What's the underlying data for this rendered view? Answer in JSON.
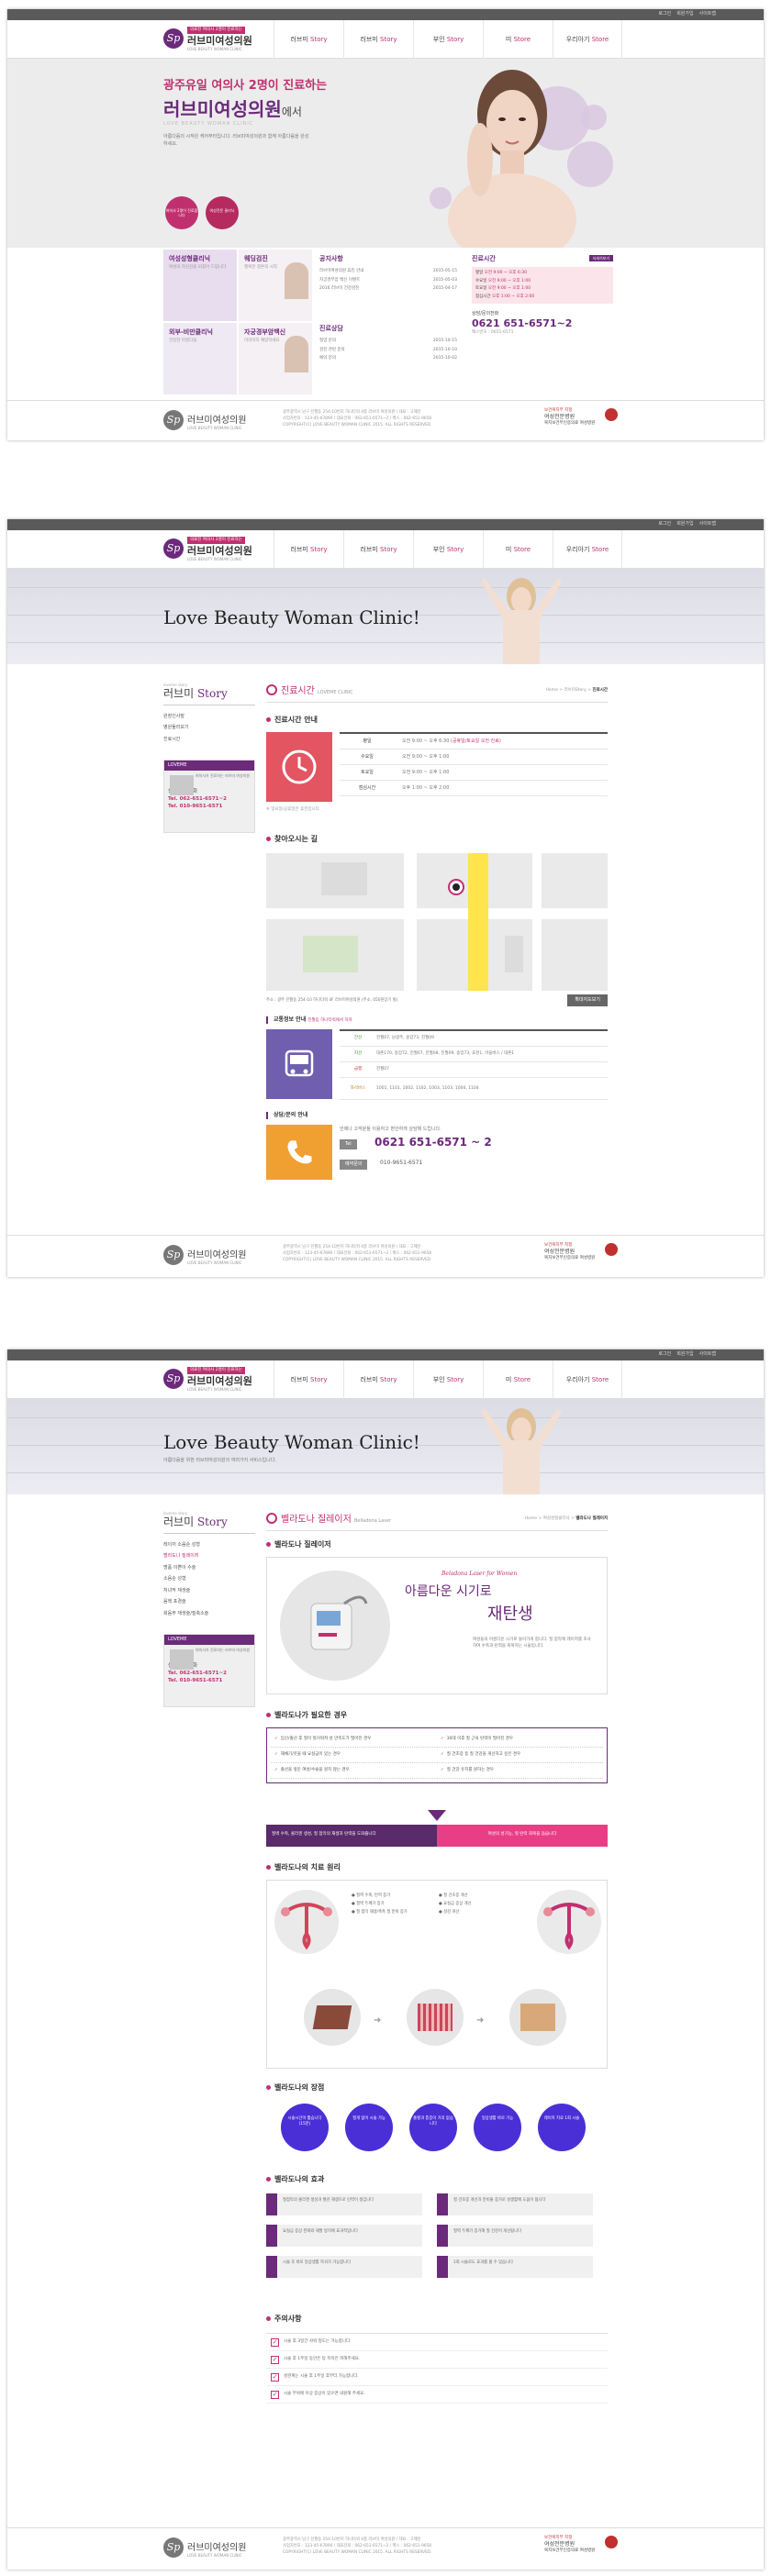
{
  "common": {
    "util": [
      "로그인",
      "회원가입",
      "사이트맵",
      "이용약관"
    ],
    "logo": {
      "mark": "Sp",
      "tagline": "의료진 여의사 2명이 진료하는",
      "name": "러브미여성의원",
      "en": "LOVE BEAUTY WOMAN CLINIC"
    },
    "nav": [
      {
        "ko": "러브미",
        "en": "Story"
      },
      {
        "ko": "러브미",
        "en": "Story"
      },
      {
        "ko": "부인",
        "en": "Story"
      },
      {
        "ko": "미",
        "en": "Store"
      },
      {
        "ko": "우리아기",
        "en": "Store"
      }
    ],
    "footer": {
      "logo_name": "러브미여성의원",
      "logo_en": "LOVE BEAUTY WOMAN CLINIC",
      "addr": "광주광역시 남구 진월동 254-10번지 하나타워 4층 러브미 여성의원 / 대표 : 고혜진",
      "addr2": "사업자번호 : 123-45-67890 / 대표전화 : 062-651-6571~2 / 팩스 : 062-651-9658",
      "copyright": "COPYRIGHT(C) LOVE BEAUTY WOMAN CLINIC 2015. ALL RIGHTS RESERVED.",
      "cert": "보건복지부 지정",
      "cert2": "여성전문병원",
      "cert3": "복지보건부인증의료 여성병원"
    }
  },
  "main": {
    "headline1": "광주유일 여의사 2명이 진료하는",
    "headline2": "러브미여성의원",
    "headline2_suffix": "에서",
    "headline_en": "LOVE BEAUTY WOMAN CLINIC",
    "desc": "아름다움의 시작은 케어부터입니다. 러브미여성의원과 함께 아름다움을 완성하세요.",
    "circles": [
      "여의사 2명이 진료합니다",
      "여성전문 클리닉"
    ],
    "quick": [
      {
        "title": "여성성형클리닉",
        "sub": "여성의 자신감을 되찾아 드립니다"
      },
      {
        "title": "웨딩검진",
        "sub": "행복한 결혼의 시작"
      },
      {
        "title": "외부-비만클리닉",
        "sub": "건강한 아름다움"
      },
      {
        "title": "자궁경부암백신",
        "sub": "미리미리 예방하세요"
      }
    ],
    "notice_title": "공지사항",
    "notice": [
      {
        "t": "러브미여성의원 휴진 안내",
        "d": "2015-05-15"
      },
      {
        "t": "자궁경부암 백신 이벤트",
        "d": "2015-05-03"
      },
      {
        "t": "2016 러브미 건강검진",
        "d": "2015-04-17"
      }
    ],
    "qa_title": "진료상담",
    "qa": [
      {
        "t": "질염 문의",
        "d": "2015-10-15"
      },
      {
        "t": "검진 관련 문의",
        "d": "2015-10-10"
      },
      {
        "t": "예약 문의",
        "d": "2015-10-02"
      }
    ],
    "hours_title": "진료시간",
    "hours_btn": "자세히보기",
    "hours": [
      {
        "k": "평일",
        "v": "오전 9:00 ~ 오후 6:30"
      },
      {
        "k": "수요일",
        "v": "오전 9:00 ~ 오후 1:00"
      },
      {
        "k": "토요일",
        "v": "오전 9:00 ~ 오후 1:00"
      },
      {
        "k": "점심시간",
        "v": "오후 1:00 ~ 오후 2:00"
      }
    ],
    "tel_label": "상담/문의전화",
    "tel": "0621 651-6571~2",
    "fax": "팩스번호 : 0651-6571"
  },
  "sub1": {
    "hero_title": "Love Beauty Woman Clinic!",
    "side_label": "loveme story",
    "side_title_a": "러브미",
    "side_title_b": "Story",
    "menu": [
      "원장인사말",
      "병원둘러보기",
      "진료시간",
      "찾아오시는길"
    ],
    "card_head": "LOVEME",
    "card_text": "여의사가 진료하는 러브미 여성의원",
    "card_tel_label": "상담 문의전화",
    "card_tel": "Tel. 062-651-6571~2",
    "card_tel2": "Tel. 010-9651-6571",
    "title": "진료시간",
    "title_en": "LOVEME CLINIC",
    "bc_home": "Home",
    "bc_mid": "러브미Story",
    "bc_cur": "진료시간",
    "sec1": "진료시간 안내",
    "hours": [
      {
        "k": "평일",
        "v": "오전 9:00 ~ 오후 6:30",
        "note": "(공휴일/토요일 오전 진료)"
      },
      {
        "k": "수요일",
        "v": "오전 9:00 ~ 오후 1:00",
        "note": ""
      },
      {
        "k": "토요일",
        "v": "오전 9:00 ~ 오후 1:00",
        "note": ""
      },
      {
        "k": "점심시간",
        "v": "오후 1:00 ~ 오후 2:00",
        "note": ""
      }
    ],
    "hours_note": "※ 일요일/공휴일은 휴진입니다.",
    "sec2": "찾아오시는 길",
    "addr": "주소 : 광주 진월동 254-10 하나타워 4F 러브미여성의원 (주소, 050원장기 빌)",
    "map_btn": "확대지도보기",
    "traffic_title": "교통정보 안내",
    "traffic_sub": "진월동 하나타워에서 하차",
    "traffic": [
      {
        "k": "간선",
        "v": "진월07, 남광주, 송암73, 진월09"
      },
      {
        "k": "지선",
        "v": "대촌170, 송암72, 진월07, 진월08, 진월09, 송암73, 효천1, 마을버스 / 대촌1"
      },
      {
        "k": "급행",
        "v": "진월07"
      },
      {
        "k": "좌석버스",
        "v": "1001, 1101, 1002, 1102, 1003, 1103, 1004, 1104"
      }
    ],
    "consult_title": "상담/문의 안내",
    "consult_text": "언제나 고객분들 이용하고 편안하게 상담해 드립니다.",
    "tel_label": "Tel",
    "tel": "0621 651-6571 ~ 2",
    "fax_label": "예약문의",
    "fax": "010-9651-6571"
  },
  "sub2": {
    "hero_title": "Love Beauty Woman Clinic!",
    "hero_sub": "아름다움을 위한 러브미여성의원의 여러가지 서비스입니다.",
    "side_label": "loveme story",
    "side_title_a": "러브미",
    "side_title_b": "Story",
    "menu": [
      "레이저 소음순 성형",
      "벨라도나 질레이저",
      "명품 이쁜이 수술",
      "소음순 성형",
      "처녀막 재생술",
      "음핵 포경술",
      "회음부 재생술/질축소술"
    ],
    "card_head": "LOVEME",
    "card_text": "여의사가 진료하는 러브미 여성의원",
    "card_tel_label": "상담 문의전화",
    "card_tel": "Tel. 062-651-6571~2",
    "card_tel2": "Tel. 010-9651-6571",
    "title": "벨라도나 질레이저",
    "title_en": "Belladona Laser",
    "bc_home": "Home",
    "bc_mid": "여성성형클리닉",
    "bc_cur": "벨라도나 질레이저",
    "sec1": "벨라도나 질레이저",
    "product_en": "Beladona Laser for Women",
    "product_ko1": "아름다운 시기로",
    "product_ko2": "재탄생",
    "product_desc": "여성들의 아름다운 시기로 돌아가게 합니다. 질 점막에 레이저를 조사하여 수축과 탄력을 회복하는 시술입니다.",
    "sec2": "벨라도나가 필요한 경우",
    "checks": [
      "임신/출산 후 질이 헐거워져 성 만족도가 떨어진 경우",
      "30대 이후 질 근육 탄력이 떨어진 경우",
      "재채기/웃을 때 요실금이 있는 경우",
      "질 건조증 등 질 건강을 개선하고 싶은 경우",
      "출산을 앞둔 여성/수술을 원치 않는 경우",
      "질 건강 유지를 원하는 경우"
    ],
    "band_left": "질벽 수축, 콜라겐 생성, 질 점막의 재생과 탄력을 도와줍니다",
    "band_right": "여성의 성기능, 질 탄력 회복을 돕습니다",
    "sec3": "벨라도나의 치료 원리",
    "princ_title": "벨라도나의 치료 원리(과정) 표면적 수축, 재생",
    "princ": [
      "질벽 수축, 탄력 증가",
      "질벽 두께가 증가",
      "질 점막 재생/촉촉 질 분비 증가",
      "질 건조증 개선",
      "요실금 증상 개선",
      "성감 개선"
    ],
    "sec4": "벨라도나의 장점",
    "feat": [
      "시술시간이 짧습니다 (15분)",
      "절개 없이 시술 가능",
      "출혈과 통증이 거의 없습니다",
      "일상생활 바로 가능",
      "레이저 치료 1회 시술"
    ],
    "sec5": "벨라도나의 효과",
    "effects": [
      "질점막의 콜라겐 생성과 혈관 재생으로 탄력이 생깁니다",
      "질 건조증 개선과 분비물 증가로 성생활에 도움이 됩니다",
      "요실금 증상 완화와 재발 방지에 효과적입니다",
      "질벽 두께가 증가해 질 건강이 개선됩니다",
      "시술 후 바로 일상생활 복귀가 가능합니다",
      "1회 시술로도 효과를 볼 수 있습니다"
    ],
    "sec6": "주의사항",
    "warnings": [
      "시술 후 3일간 샤워 정도는 가능합니다.",
      "시술 후 1주일 동안은 탕 목욕은 피해주세요.",
      "성관계는 시술 후 1주일 후부터 가능합니다.",
      "시술 부위에 이상 증상이 있으면 내원해 주세요."
    ]
  },
  "colors": {
    "purple": "#6b2a7a",
    "pink": "#c03070",
    "orange": "#f0a030",
    "blue": "#4a2fd6"
  }
}
